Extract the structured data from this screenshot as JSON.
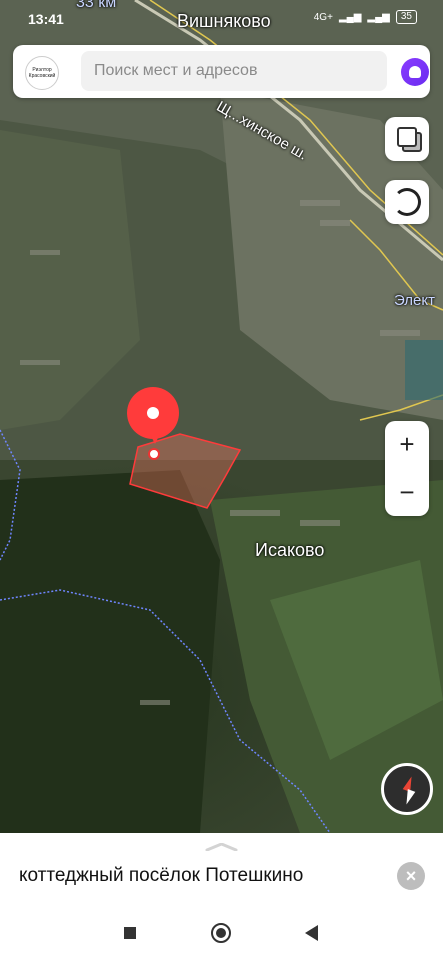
{
  "status_bar": {
    "time": "13:41",
    "network": "4G+",
    "battery": "35"
  },
  "search": {
    "placeholder": "Поиск мест и адресов",
    "logo_text": "Риэлтор Красовский"
  },
  "map": {
    "labels": {
      "top_road_km": "33 км",
      "village_north": "Вишняково",
      "highway": "Щ...хинское ш.",
      "east_partial": "Элект",
      "village_south": "Исаково"
    },
    "zoom_in": "+",
    "zoom_out": "−"
  },
  "bottom_sheet": {
    "title": "коттеджный посёлок Потешкино",
    "close": "×"
  },
  "icons": [
    "layers-icon",
    "traffic-icon",
    "alice-icon",
    "compass-icon",
    "location-pin-icon",
    "close-icon"
  ]
}
